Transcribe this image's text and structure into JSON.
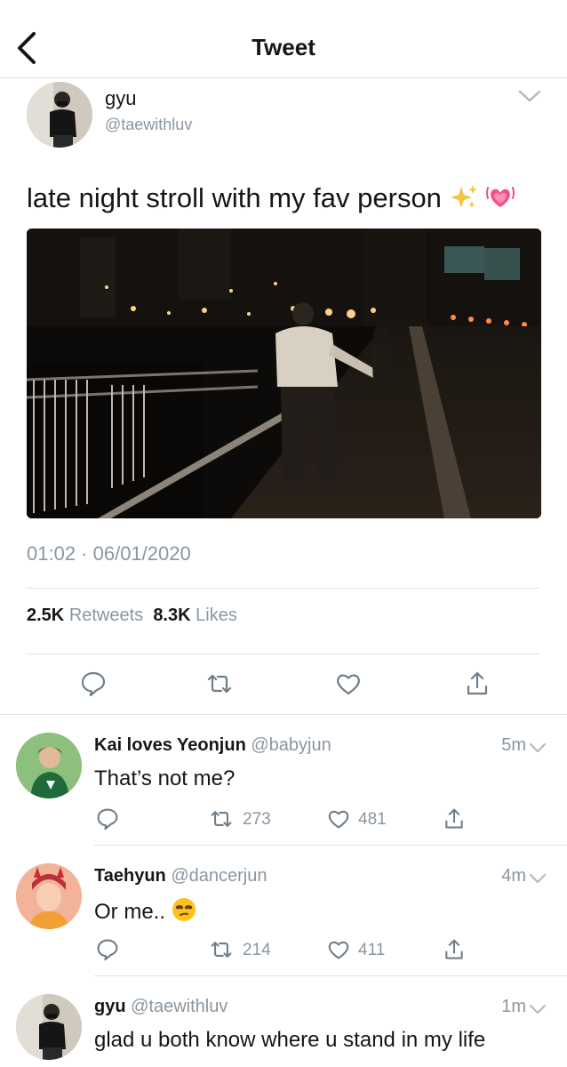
{
  "header": {
    "title": "Tweet"
  },
  "tweet": {
    "name": "gyu",
    "handle": "@taewithluv",
    "text": "late night stroll with my fav person",
    "timestamp": "01:02 · 06/01/2020",
    "retweets_count": "2.5K",
    "retweets_label": "Retweets",
    "likes_count": "8.3K",
    "likes_label": "Likes"
  },
  "replies": [
    {
      "name": "Kai loves Yeonjun",
      "handle": "@babyjun",
      "time": "5m",
      "text": "That’s not me?",
      "retweets": "273",
      "likes": "481"
    },
    {
      "name": "Taehyun",
      "handle": "@dancerjun",
      "time": "4m",
      "text": "Or me..",
      "retweets": "214",
      "likes": "411"
    },
    {
      "name": "gyu",
      "handle": "@taewithluv",
      "time": "1m",
      "text": "glad u both know where u stand in my life"
    }
  ],
  "colors": {
    "text": "#14171a",
    "secondary": "#8a96a0",
    "icon": "#6f7d88",
    "divider": "#dfe3e7"
  },
  "icons": [
    "back-arrow-icon",
    "chevron-down-icon",
    "sparkles-emoji",
    "growing-heart-emoji",
    "reply-icon",
    "retweet-icon",
    "like-icon",
    "share-icon",
    "unamused-face-emoji"
  ]
}
